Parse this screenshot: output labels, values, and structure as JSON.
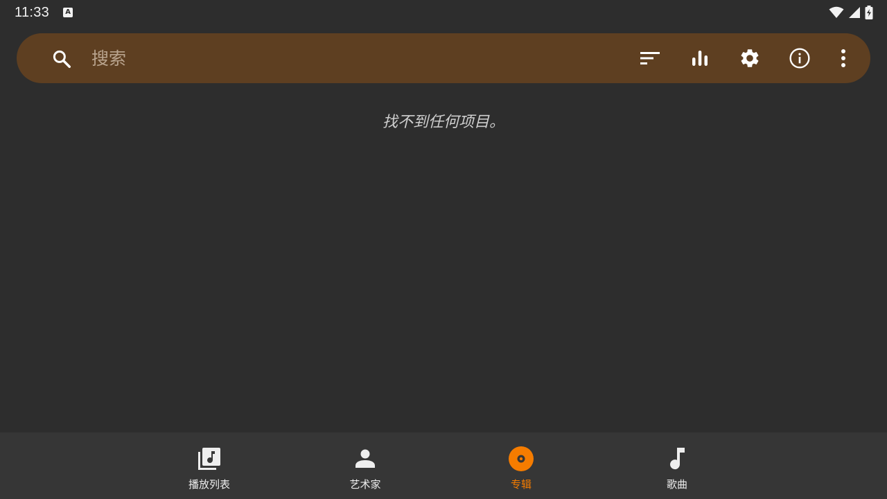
{
  "status_bar": {
    "time": "11:33",
    "notification_icon": "text-a-icon",
    "icons": [
      "wifi-icon",
      "signal-icon",
      "battery-charging-icon"
    ]
  },
  "search": {
    "placeholder": "搜索",
    "value": "",
    "actions": [
      "sort-icon",
      "equalizer-icon",
      "settings-gear-icon",
      "info-icon",
      "more-vert-icon"
    ]
  },
  "main": {
    "empty_message": "找不到任何项目。"
  },
  "bottom_nav": {
    "items": [
      {
        "label": "播放列表",
        "icon": "playlist-icon",
        "active": false
      },
      {
        "label": "艺术家",
        "icon": "artist-icon",
        "active": false
      },
      {
        "label": "专辑",
        "icon": "album-icon",
        "active": true
      },
      {
        "label": "歌曲",
        "icon": "song-icon",
        "active": false
      }
    ]
  },
  "colors": {
    "background": "#2d2d2d",
    "search_bar": "#5e3f21",
    "bottom_nav": "#363636",
    "accent": "#f57c00",
    "placeholder": "#b9a48e"
  }
}
